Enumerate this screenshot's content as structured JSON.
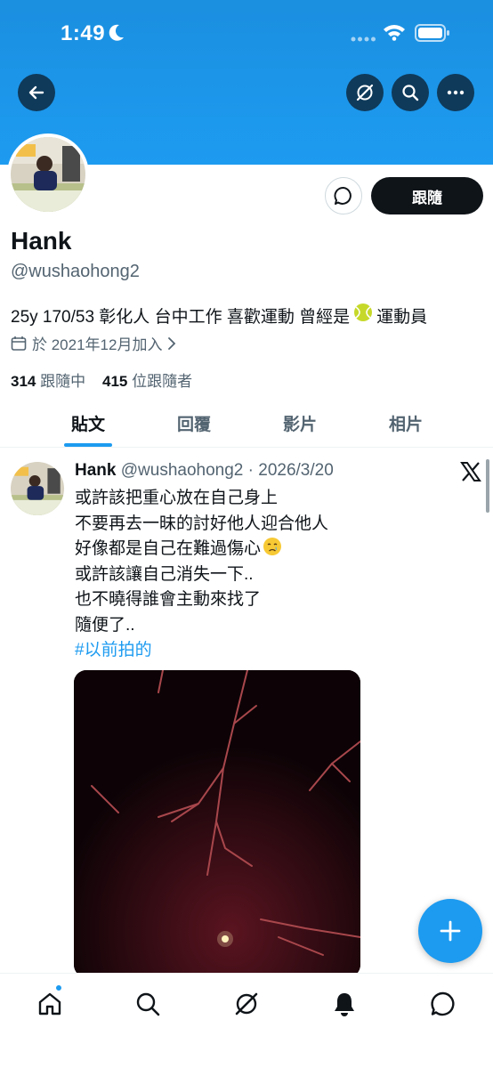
{
  "status_bar": {
    "time": "1:49",
    "icons": [
      "moon-icon",
      "signal-dots-icon",
      "wifi-icon",
      "battery-icon"
    ]
  },
  "header": {
    "buttons": [
      "back-arrow-icon",
      "grok-icon",
      "search-icon",
      "more-icon"
    ]
  },
  "profile": {
    "name": "Hank",
    "handle": "@wushaohong2",
    "bio_before_emoji": "25y 170/53 彰化人 台中工作 喜歡運動 曾經是",
    "bio_emoji": "tennis-ball",
    "bio_after_emoji": "運動員",
    "joined": "於 2021年12月加入",
    "following_count": "314",
    "following_label": "跟隨中",
    "followers_count": "415",
    "followers_label": "位跟隨者",
    "follow_button": "跟隨",
    "message_button_icon": "message-icon"
  },
  "tabs": [
    {
      "label": "貼文",
      "active": true
    },
    {
      "label": "回覆",
      "active": false
    },
    {
      "label": "影片",
      "active": false
    },
    {
      "label": "相片",
      "active": false
    }
  ],
  "post": {
    "author_name": "Hank",
    "author_meta": "@wushaohong2 · 2026/3/20",
    "lines": [
      "或許該把重心放在自己身上",
      "不要再去一昧的討好他人迎合他人",
      "好像都是自己在難過傷心",
      "或許該讓自己消失一下..",
      "也不曉得誰會主動來找了",
      "隨便了.."
    ],
    "line3_emoji": "crying-face",
    "hashtag": "#以前拍的",
    "source_icon": "x-logo-icon"
  },
  "fab": {
    "icon": "plus-icon"
  },
  "bottom_nav": [
    {
      "icon": "home-icon",
      "notification_dot": true
    },
    {
      "icon": "search-icon",
      "notification_dot": false
    },
    {
      "icon": "grok-icon",
      "notification_dot": false
    },
    {
      "icon": "bell-icon",
      "notification_dot": false
    },
    {
      "icon": "messages-icon",
      "notification_dot": false
    }
  ],
  "colors": {
    "banner": "#1d9bf0",
    "accent": "#1d9bf0",
    "text_primary": "#0f1419",
    "text_secondary": "#536471",
    "header_button_bg": "#0f3a5a"
  }
}
